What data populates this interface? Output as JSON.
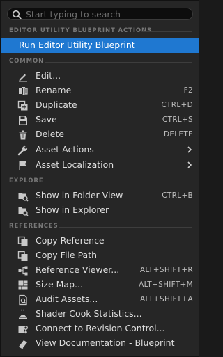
{
  "search": {
    "placeholder": "Start typing to search"
  },
  "sections": {
    "editor_utility": "EDITOR UTILITY BLUEPRINT ACTIONS",
    "common": "COMMON",
    "explore": "EXPLORE",
    "references": "REFERENCES"
  },
  "editor_utility_items": [
    {
      "label": "Run Editor Utility Blueprint",
      "selected": true
    }
  ],
  "common_items": [
    {
      "label": "Edit...",
      "shortcut": "",
      "icon": "pencil-icon"
    },
    {
      "label": "Rename",
      "shortcut": "F2",
      "icon": "rename-icon"
    },
    {
      "label": "Duplicate",
      "shortcut": "CTRL+D",
      "icon": "duplicate-icon"
    },
    {
      "label": "Save",
      "shortcut": "CTRL+S",
      "icon": "save-icon"
    },
    {
      "label": "Delete",
      "shortcut": "DELETE",
      "icon": "trash-icon"
    },
    {
      "label": "Asset Actions",
      "shortcut": "",
      "icon": "wrench-icon",
      "submenu": true
    },
    {
      "label": "Asset Localization",
      "shortcut": "",
      "icon": "flag-icon",
      "submenu": true
    }
  ],
  "explore_items": [
    {
      "label": "Show in Folder View",
      "shortcut": "CTRL+B",
      "icon": "folder-search-icon"
    },
    {
      "label": "Show in Explorer",
      "shortcut": "",
      "icon": "folder-search-icon"
    }
  ],
  "references_items": [
    {
      "label": "Copy Reference",
      "shortcut": "",
      "icon": "copy-icon"
    },
    {
      "label": "Copy File Path",
      "shortcut": "",
      "icon": "copy-icon"
    },
    {
      "label": "Reference Viewer...",
      "shortcut": "ALT+SHIFT+R",
      "icon": "reference-viewer-icon"
    },
    {
      "label": "Size Map...",
      "shortcut": "ALT+SHIFT+M",
      "icon": "size-map-icon"
    },
    {
      "label": "Audit Assets...",
      "shortcut": "ALT+SHIFT+A",
      "icon": "audit-icon"
    },
    {
      "label": "Shader Cook Statistics...",
      "shortcut": "",
      "icon": "shader-icon"
    },
    {
      "label": "Connect to Revision Control...",
      "shortcut": "",
      "icon": "revision-control-icon"
    },
    {
      "label": "View Documentation - Blueprint",
      "shortcut": "",
      "icon": "book-icon"
    }
  ],
  "colors": {
    "selection": "#1f78d1",
    "background": "#262626"
  }
}
